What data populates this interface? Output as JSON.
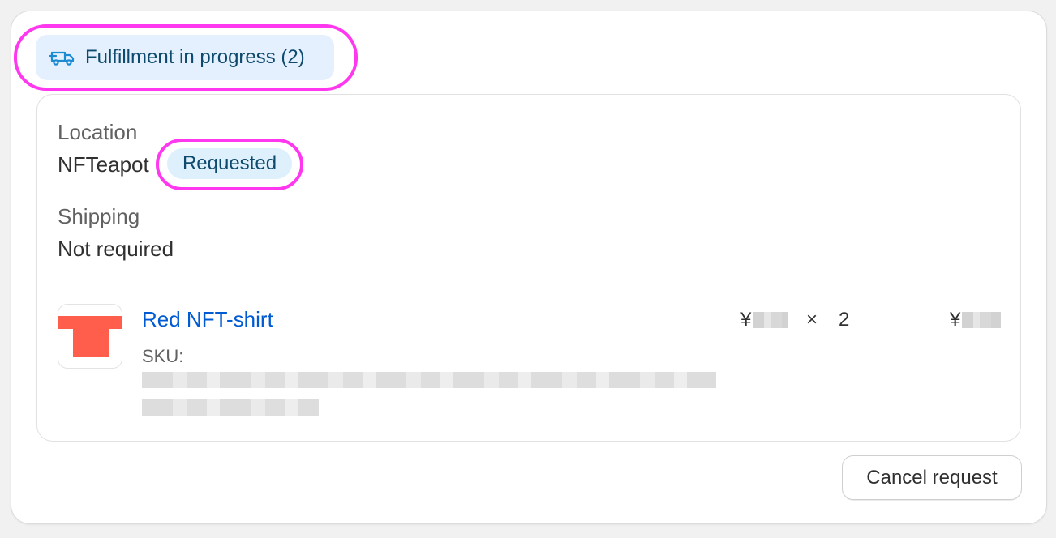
{
  "fulfillment": {
    "status_label": "Fulfillment in progress (2)",
    "status_icon": "delivery-truck-icon"
  },
  "location": {
    "label": "Location",
    "value": "NFTeapot",
    "badge": "Requested"
  },
  "shipping": {
    "label": "Shipping",
    "value": "Not required"
  },
  "line_item": {
    "title": "Red NFT-shirt",
    "sku_label": "SKU:",
    "thumbnail_icon": "red-tshirt-icon",
    "thumbnail_color": "#ff5e4d",
    "unit_price_prefix": "¥",
    "times_symbol": "×",
    "quantity": "2",
    "total_prefix": "¥"
  },
  "actions": {
    "cancel_label": "Cancel request"
  },
  "colors": {
    "highlight_ring": "#ff38f0",
    "badge_bg": "#e4f0fd",
    "badge_text": "#0e4a6d",
    "link": "#005bd3"
  }
}
